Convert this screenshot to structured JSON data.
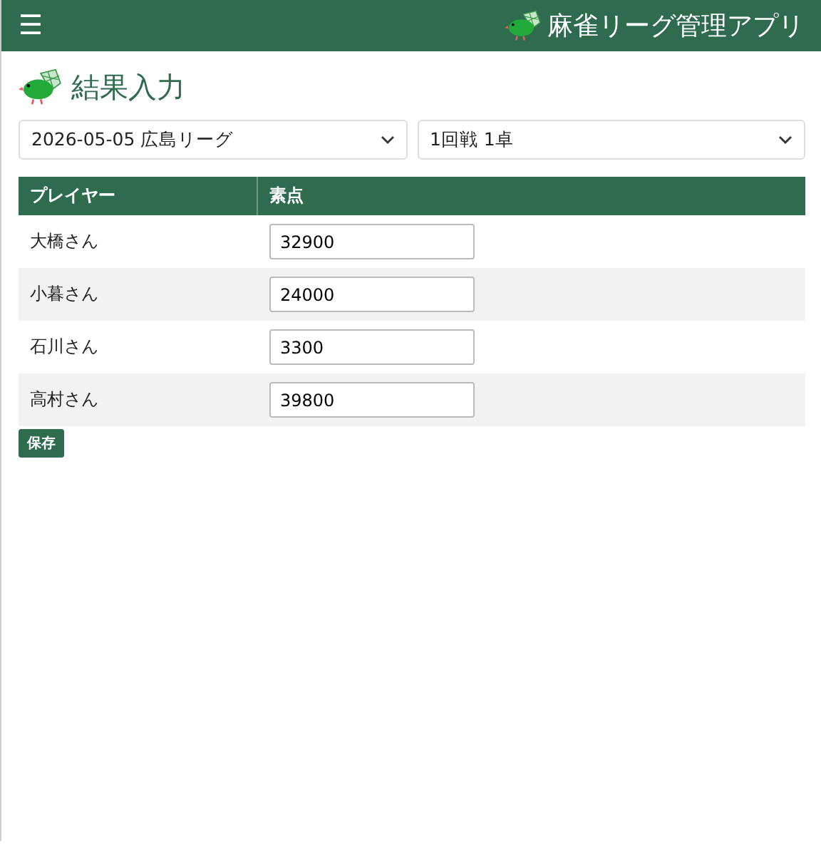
{
  "header": {
    "menu_icon": "☰",
    "app_title": "麻雀リーグ管理アプリ"
  },
  "page_title": "結果入力",
  "selects": [
    {
      "value": "2026-05-05 広島リーグ"
    },
    {
      "value": "1回戦 1卓"
    }
  ],
  "table": {
    "columns": [
      "プレイヤー",
      "素点"
    ],
    "rows": [
      {
        "player": "大橋さん",
        "score": "32900"
      },
      {
        "player": "小暮さん",
        "score": "24000"
      },
      {
        "player": "石川さん",
        "score": "3300"
      },
      {
        "player": "高村さん",
        "score": "39800"
      }
    ]
  },
  "save_button": "保存"
}
